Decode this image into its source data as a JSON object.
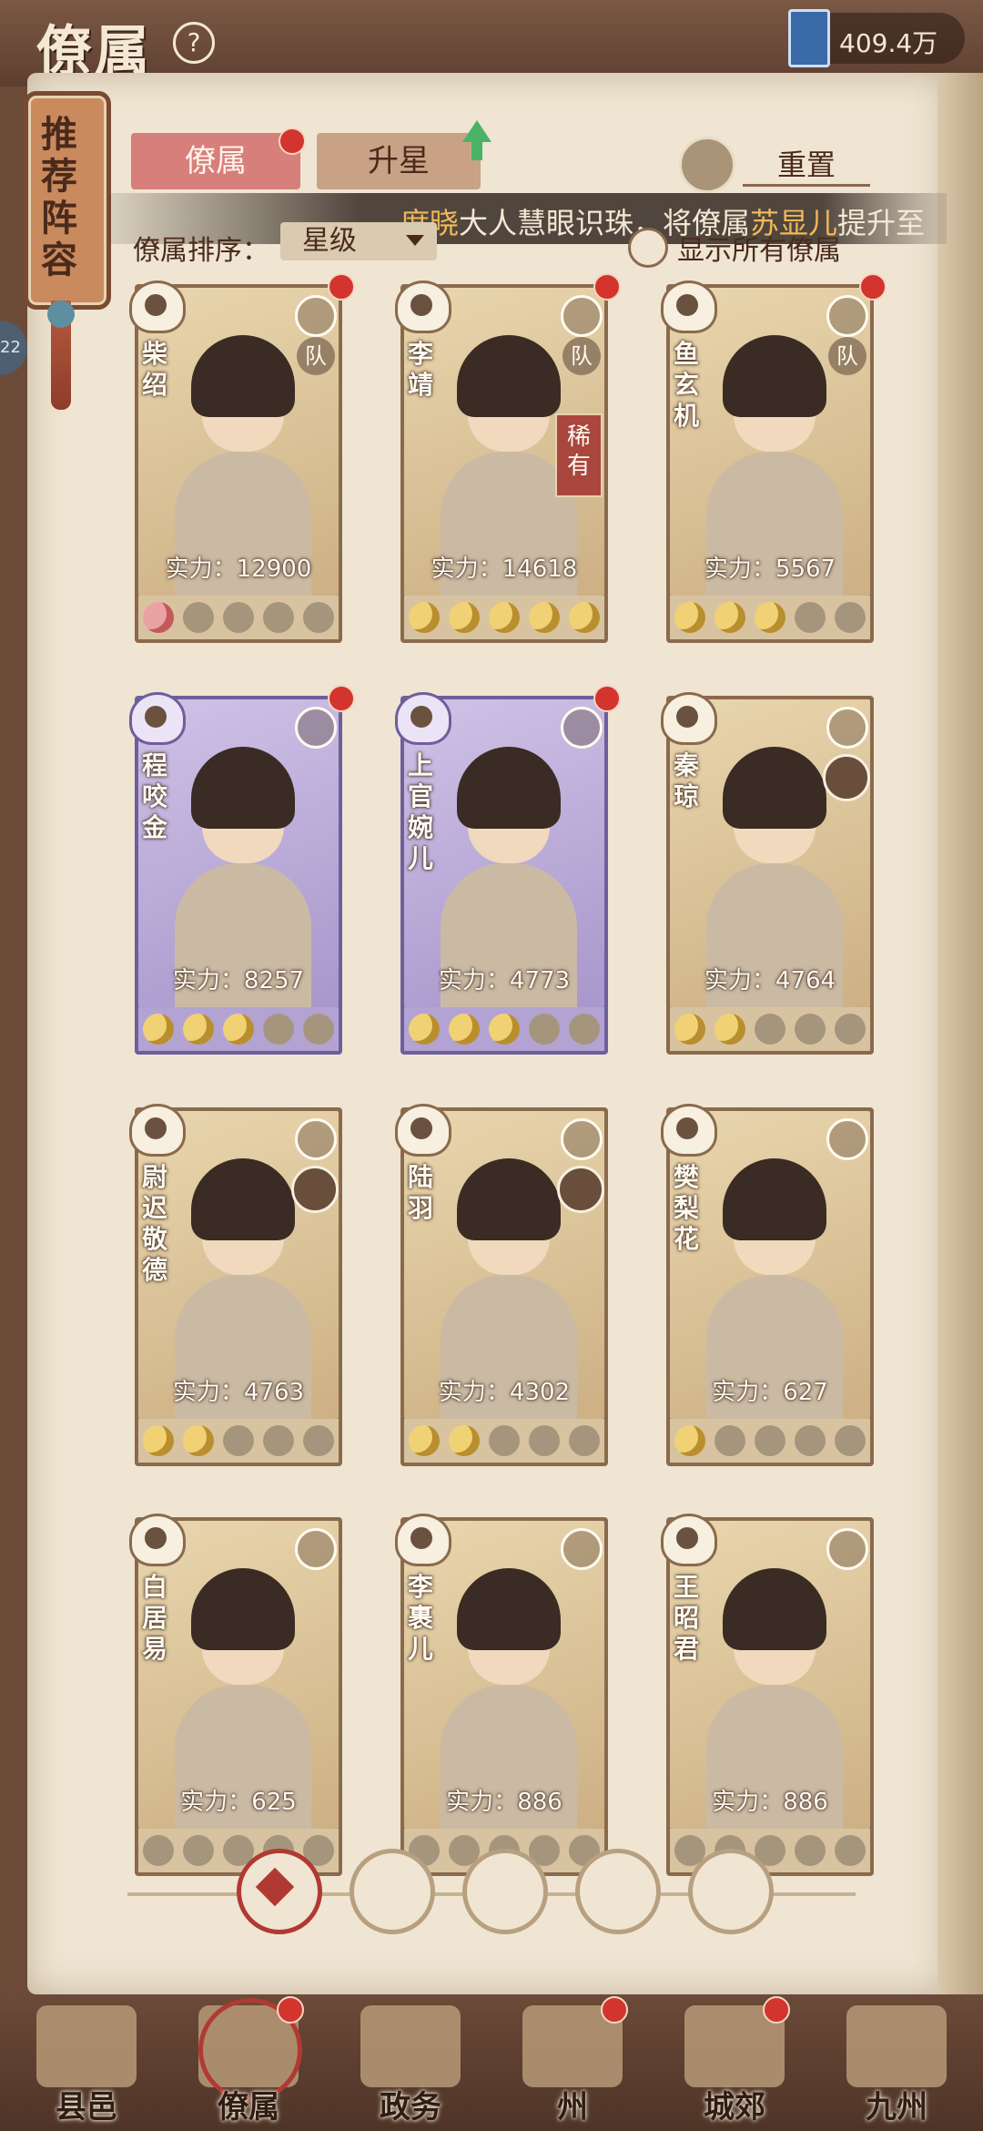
{
  "header": {
    "title": "僚属",
    "help_icon": "question-icon",
    "currency": {
      "icon": "blue-book-icon",
      "value": "409.4万"
    }
  },
  "sidebar_banner": {
    "text": "推荐阵容"
  },
  "side_chip": {
    "text": "22"
  },
  "tabs": [
    {
      "label": "僚属",
      "active": true,
      "has_badge": true
    },
    {
      "label": "升星",
      "active": false,
      "has_upgrade_arrow": true
    }
  ],
  "reset": {
    "label": "重置"
  },
  "marquee": {
    "name1": "席晓",
    "text1": "大人慧眼识珠，将僚属",
    "name2": "苏显儿",
    "text2": "提升至"
  },
  "sort": {
    "label": "僚属排序：",
    "value": "星级"
  },
  "show_all": {
    "label": "显示所有僚属",
    "checked": false
  },
  "power_prefix": "实力：",
  "team_label": "队",
  "rare_label": "稀有",
  "cards": [
    {
      "name": "柴绍",
      "power": "12900",
      "rarity": "gold",
      "stars": 1,
      "half_first": true,
      "team": true,
      "badge": true
    },
    {
      "name": "李靖",
      "power": "14618",
      "rarity": "gold",
      "stars": 5,
      "team": true,
      "rare": true,
      "badge": true
    },
    {
      "name": "鱼玄机",
      "power": "5567",
      "rarity": "gold",
      "stars": 3,
      "team": true,
      "badge": true
    },
    {
      "name": "程咬金",
      "power": "8257",
      "rarity": "purple",
      "stars": 3,
      "badge": true
    },
    {
      "name": "上官婉儿",
      "power": "4773",
      "rarity": "purple",
      "stars": 3,
      "badge": true
    },
    {
      "name": "秦琼",
      "power": "4764",
      "rarity": "gold",
      "stars": 2,
      "avatar": true
    },
    {
      "name": "尉迟敬德",
      "power": "4763",
      "rarity": "gold",
      "stars": 2,
      "avatar": true
    },
    {
      "name": "陆羽",
      "power": "4302",
      "rarity": "gold",
      "stars": 2,
      "avatar": true
    },
    {
      "name": "樊梨花",
      "power": "627",
      "rarity": "gold",
      "stars": 1
    },
    {
      "name": "白居易",
      "power": "625",
      "rarity": "gold",
      "stars": 0
    },
    {
      "name": "李裹儿",
      "power": "886",
      "rarity": "gold",
      "stars": 0
    },
    {
      "name": "王昭君",
      "power": "886",
      "rarity": "gold",
      "stars": 0
    }
  ],
  "filters": [
    {
      "icon": "all-diamond-icon",
      "active": true
    },
    {
      "icon": "bell-faction-icon",
      "active": false
    },
    {
      "icon": "cat-faction-icon",
      "active": false
    },
    {
      "icon": "fan-faction-icon",
      "active": false
    },
    {
      "icon": "lion-faction-icon",
      "active": false
    }
  ],
  "nav": [
    {
      "label": "县邑",
      "badge": false
    },
    {
      "label": "僚属",
      "badge": true,
      "active": true
    },
    {
      "label": "政务",
      "badge": false
    },
    {
      "label": "州",
      "badge": true
    },
    {
      "label": "城郊",
      "badge": true
    },
    {
      "label": "九州",
      "badge": false
    }
  ]
}
